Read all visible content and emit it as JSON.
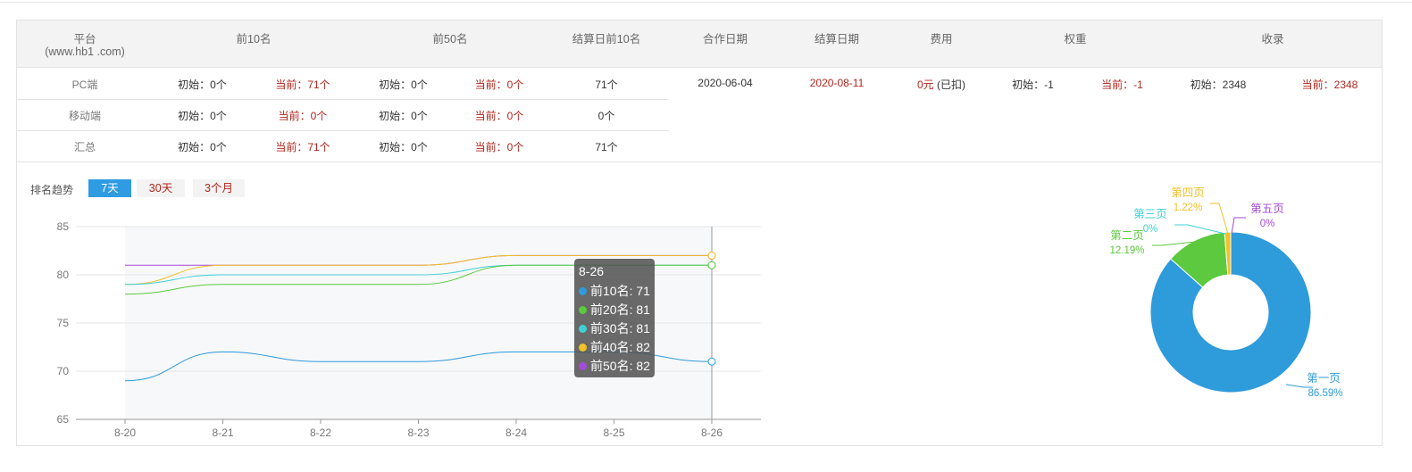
{
  "header": {
    "platform": "平台",
    "platform_domain": "(www.hb1     .com)",
    "top10": "前10名",
    "top50": "前50名",
    "settle_top10": "结算日前10名",
    "coop_date": "合作日期",
    "settle_date": "结算日期",
    "fee": "费用",
    "weight": "权重",
    "index": "收录"
  },
  "rows": [
    {
      "label": "PC端",
      "t10_init": "初始：0个",
      "t10_cur": "当前：71个",
      "t50_init": "初始：0个",
      "t50_cur": "当前：0个",
      "settle": "71个"
    },
    {
      "label": "移动端",
      "t10_init": "初始：0个",
      "t10_cur": "当前：0个",
      "t50_init": "初始：0个",
      "t50_cur": "当前：0个",
      "settle": "0个"
    },
    {
      "label": "汇总",
      "t10_init": "初始：0个",
      "t10_cur": "当前：71个",
      "t50_init": "初始：0个",
      "t50_cur": "当前：0个",
      "settle": "71个"
    }
  ],
  "summary": {
    "coop_date": "2020-06-04",
    "settle_date": "2020-08-11",
    "fee_amount": "0元",
    "fee_note": "(已扣)",
    "weight_init": "初始：-1",
    "weight_cur": "当前：-1",
    "index_init": "初始：2348",
    "index_cur": "当前：2348"
  },
  "trend": {
    "label": "排名趋势",
    "ranges": [
      "7天",
      "30天",
      "3个月"
    ],
    "active_range": "7天"
  },
  "tooltip": {
    "title": "8-26",
    "items": [
      "前10名: 71",
      "前20名: 81",
      "前30名: 81",
      "前40名: 82",
      "前50名: 82"
    ]
  },
  "colors": {
    "accent": "#2f9be3",
    "red": "#b1251c",
    "s1": "#2e9bdb",
    "s2": "#5cc93f",
    "s3": "#3fcfd6",
    "s4": "#f3c026",
    "s5": "#a54bd9"
  },
  "chart_data": [
    {
      "type": "line",
      "x": [
        "8-20",
        "8-21",
        "8-22",
        "8-23",
        "8-24",
        "8-25",
        "8-26"
      ],
      "ylim": [
        65,
        85
      ],
      "yticks": [
        65,
        70,
        75,
        80,
        85
      ],
      "series": [
        {
          "name": "前10名",
          "values": [
            69,
            72,
            71,
            71,
            72,
            72,
            71
          ]
        },
        {
          "name": "前20名",
          "values": [
            78,
            79,
            79,
            79,
            81,
            81,
            81
          ]
        },
        {
          "name": "前30名",
          "values": [
            79,
            80,
            80,
            80,
            81,
            81,
            81
          ]
        },
        {
          "name": "前40名",
          "values": [
            79,
            81,
            81,
            81,
            82,
            82,
            82
          ]
        },
        {
          "name": "前50名",
          "values": [
            81,
            81,
            81,
            81,
            82,
            82,
            82
          ]
        }
      ]
    },
    {
      "type": "pie",
      "donut": true,
      "categories": [
        "第一页",
        "第二页",
        "第三页",
        "第四页",
        "第五页"
      ],
      "values": [
        86.59,
        12.19,
        0,
        1.22,
        0
      ],
      "labels": [
        "86.59%",
        "12.19%",
        "0%",
        "1.22%",
        "0%"
      ]
    }
  ]
}
